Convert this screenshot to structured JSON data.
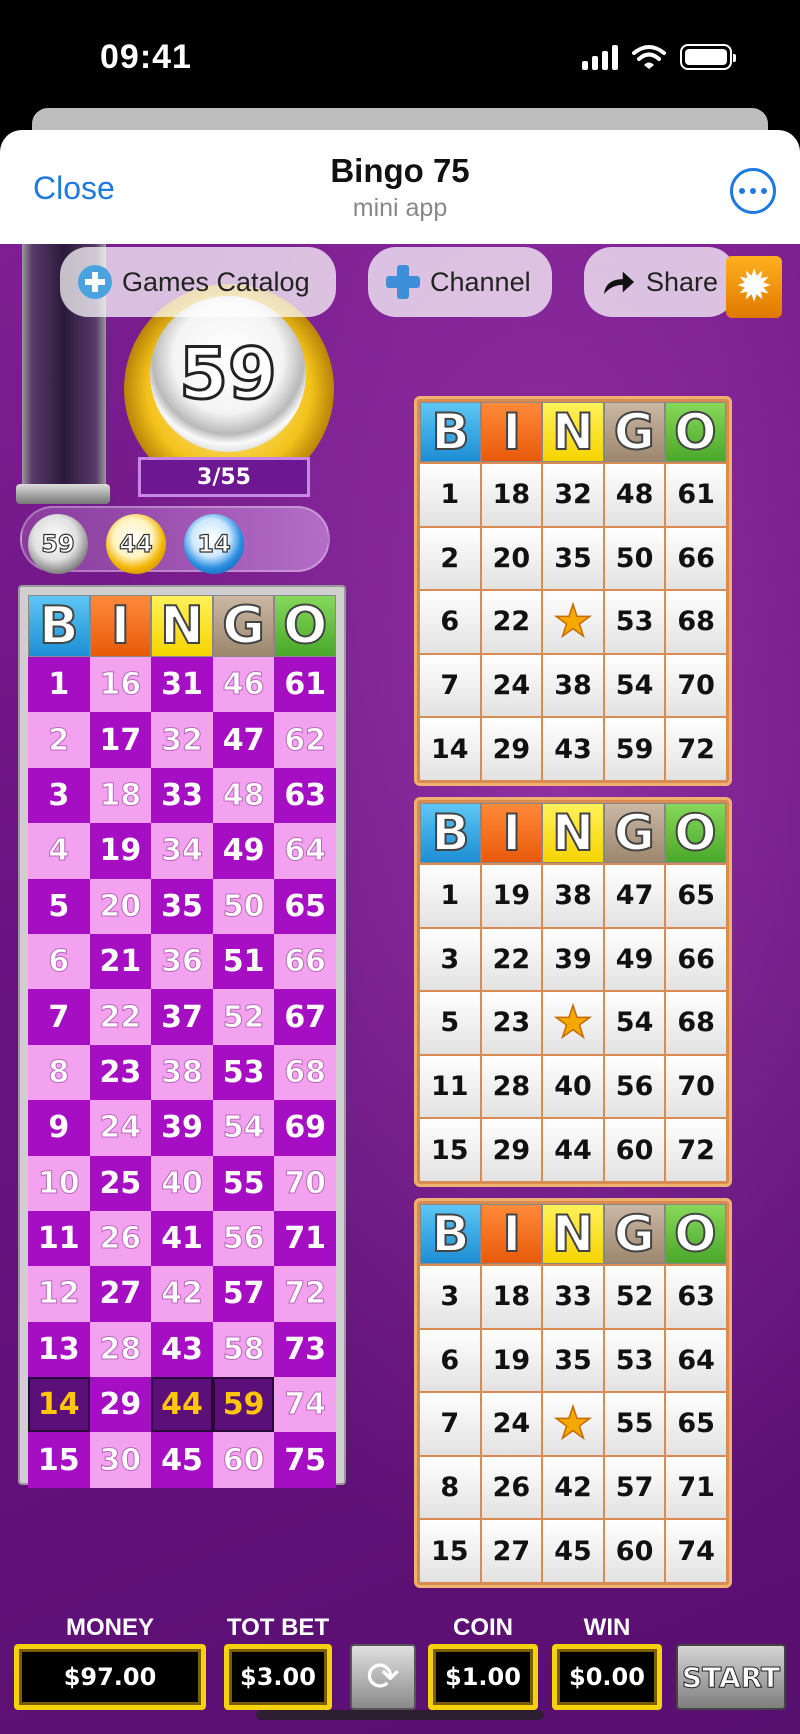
{
  "status_bar": {
    "time": "09:41"
  },
  "header": {
    "close_label": "Close",
    "title": "Bingo 75",
    "subtitle": "mini app"
  },
  "toolbar": {
    "games_catalog": "Games Catalog",
    "channel": "Channel",
    "share": "Share"
  },
  "draw": {
    "current_ball": "59",
    "count": "3/55",
    "recent_balls": [
      "59",
      "44",
      "14"
    ]
  },
  "bingo_letters": [
    "B",
    "I",
    "N",
    "G",
    "O"
  ],
  "master_board": {
    "rows": [
      [
        "1",
        "16",
        "31",
        "46",
        "61"
      ],
      [
        "2",
        "17",
        "32",
        "47",
        "62"
      ],
      [
        "3",
        "18",
        "33",
        "48",
        "63"
      ],
      [
        "4",
        "19",
        "34",
        "49",
        "64"
      ],
      [
        "5",
        "20",
        "35",
        "50",
        "65"
      ],
      [
        "6",
        "21",
        "36",
        "51",
        "66"
      ],
      [
        "7",
        "22",
        "37",
        "52",
        "67"
      ],
      [
        "8",
        "23",
        "38",
        "53",
        "68"
      ],
      [
        "9",
        "24",
        "39",
        "54",
        "69"
      ],
      [
        "10",
        "25",
        "40",
        "55",
        "70"
      ],
      [
        "11",
        "26",
        "41",
        "56",
        "71"
      ],
      [
        "12",
        "27",
        "42",
        "57",
        "72"
      ],
      [
        "13",
        "28",
        "43",
        "58",
        "73"
      ],
      [
        "14",
        "29",
        "44",
        "59",
        "74"
      ],
      [
        "15",
        "30",
        "45",
        "60",
        "75"
      ]
    ],
    "called": [
      "14",
      "44",
      "59"
    ]
  },
  "cards": [
    {
      "rows": [
        [
          "1",
          "18",
          "32",
          "48",
          "61"
        ],
        [
          "2",
          "20",
          "35",
          "50",
          "66"
        ],
        [
          "6",
          "22",
          "★",
          "53",
          "68"
        ],
        [
          "7",
          "24",
          "38",
          "54",
          "70"
        ],
        [
          "14",
          "29",
          "43",
          "59",
          "72"
        ]
      ]
    },
    {
      "rows": [
        [
          "1",
          "19",
          "38",
          "47",
          "65"
        ],
        [
          "3",
          "22",
          "39",
          "49",
          "66"
        ],
        [
          "5",
          "23",
          "★",
          "54",
          "68"
        ],
        [
          "11",
          "28",
          "40",
          "56",
          "70"
        ],
        [
          "15",
          "29",
          "44",
          "60",
          "72"
        ]
      ]
    },
    {
      "rows": [
        [
          "3",
          "18",
          "33",
          "52",
          "63"
        ],
        [
          "6",
          "19",
          "35",
          "53",
          "64"
        ],
        [
          "7",
          "24",
          "★",
          "55",
          "65"
        ],
        [
          "8",
          "26",
          "42",
          "57",
          "71"
        ],
        [
          "15",
          "27",
          "45",
          "60",
          "74"
        ]
      ]
    }
  ],
  "bottom_bar": {
    "money_label": "MONEY",
    "money": "$97.00",
    "totbet_label": "TOT BET",
    "totbet": "$3.00",
    "coin_label": "COIN",
    "coin": "$1.00",
    "win_label": "WIN",
    "win": "$0.00",
    "start": "START"
  },
  "icons": {
    "gear": "gear-icon",
    "refresh": "refresh-icon",
    "share": "share-arrow-icon",
    "more": "more-icon"
  }
}
